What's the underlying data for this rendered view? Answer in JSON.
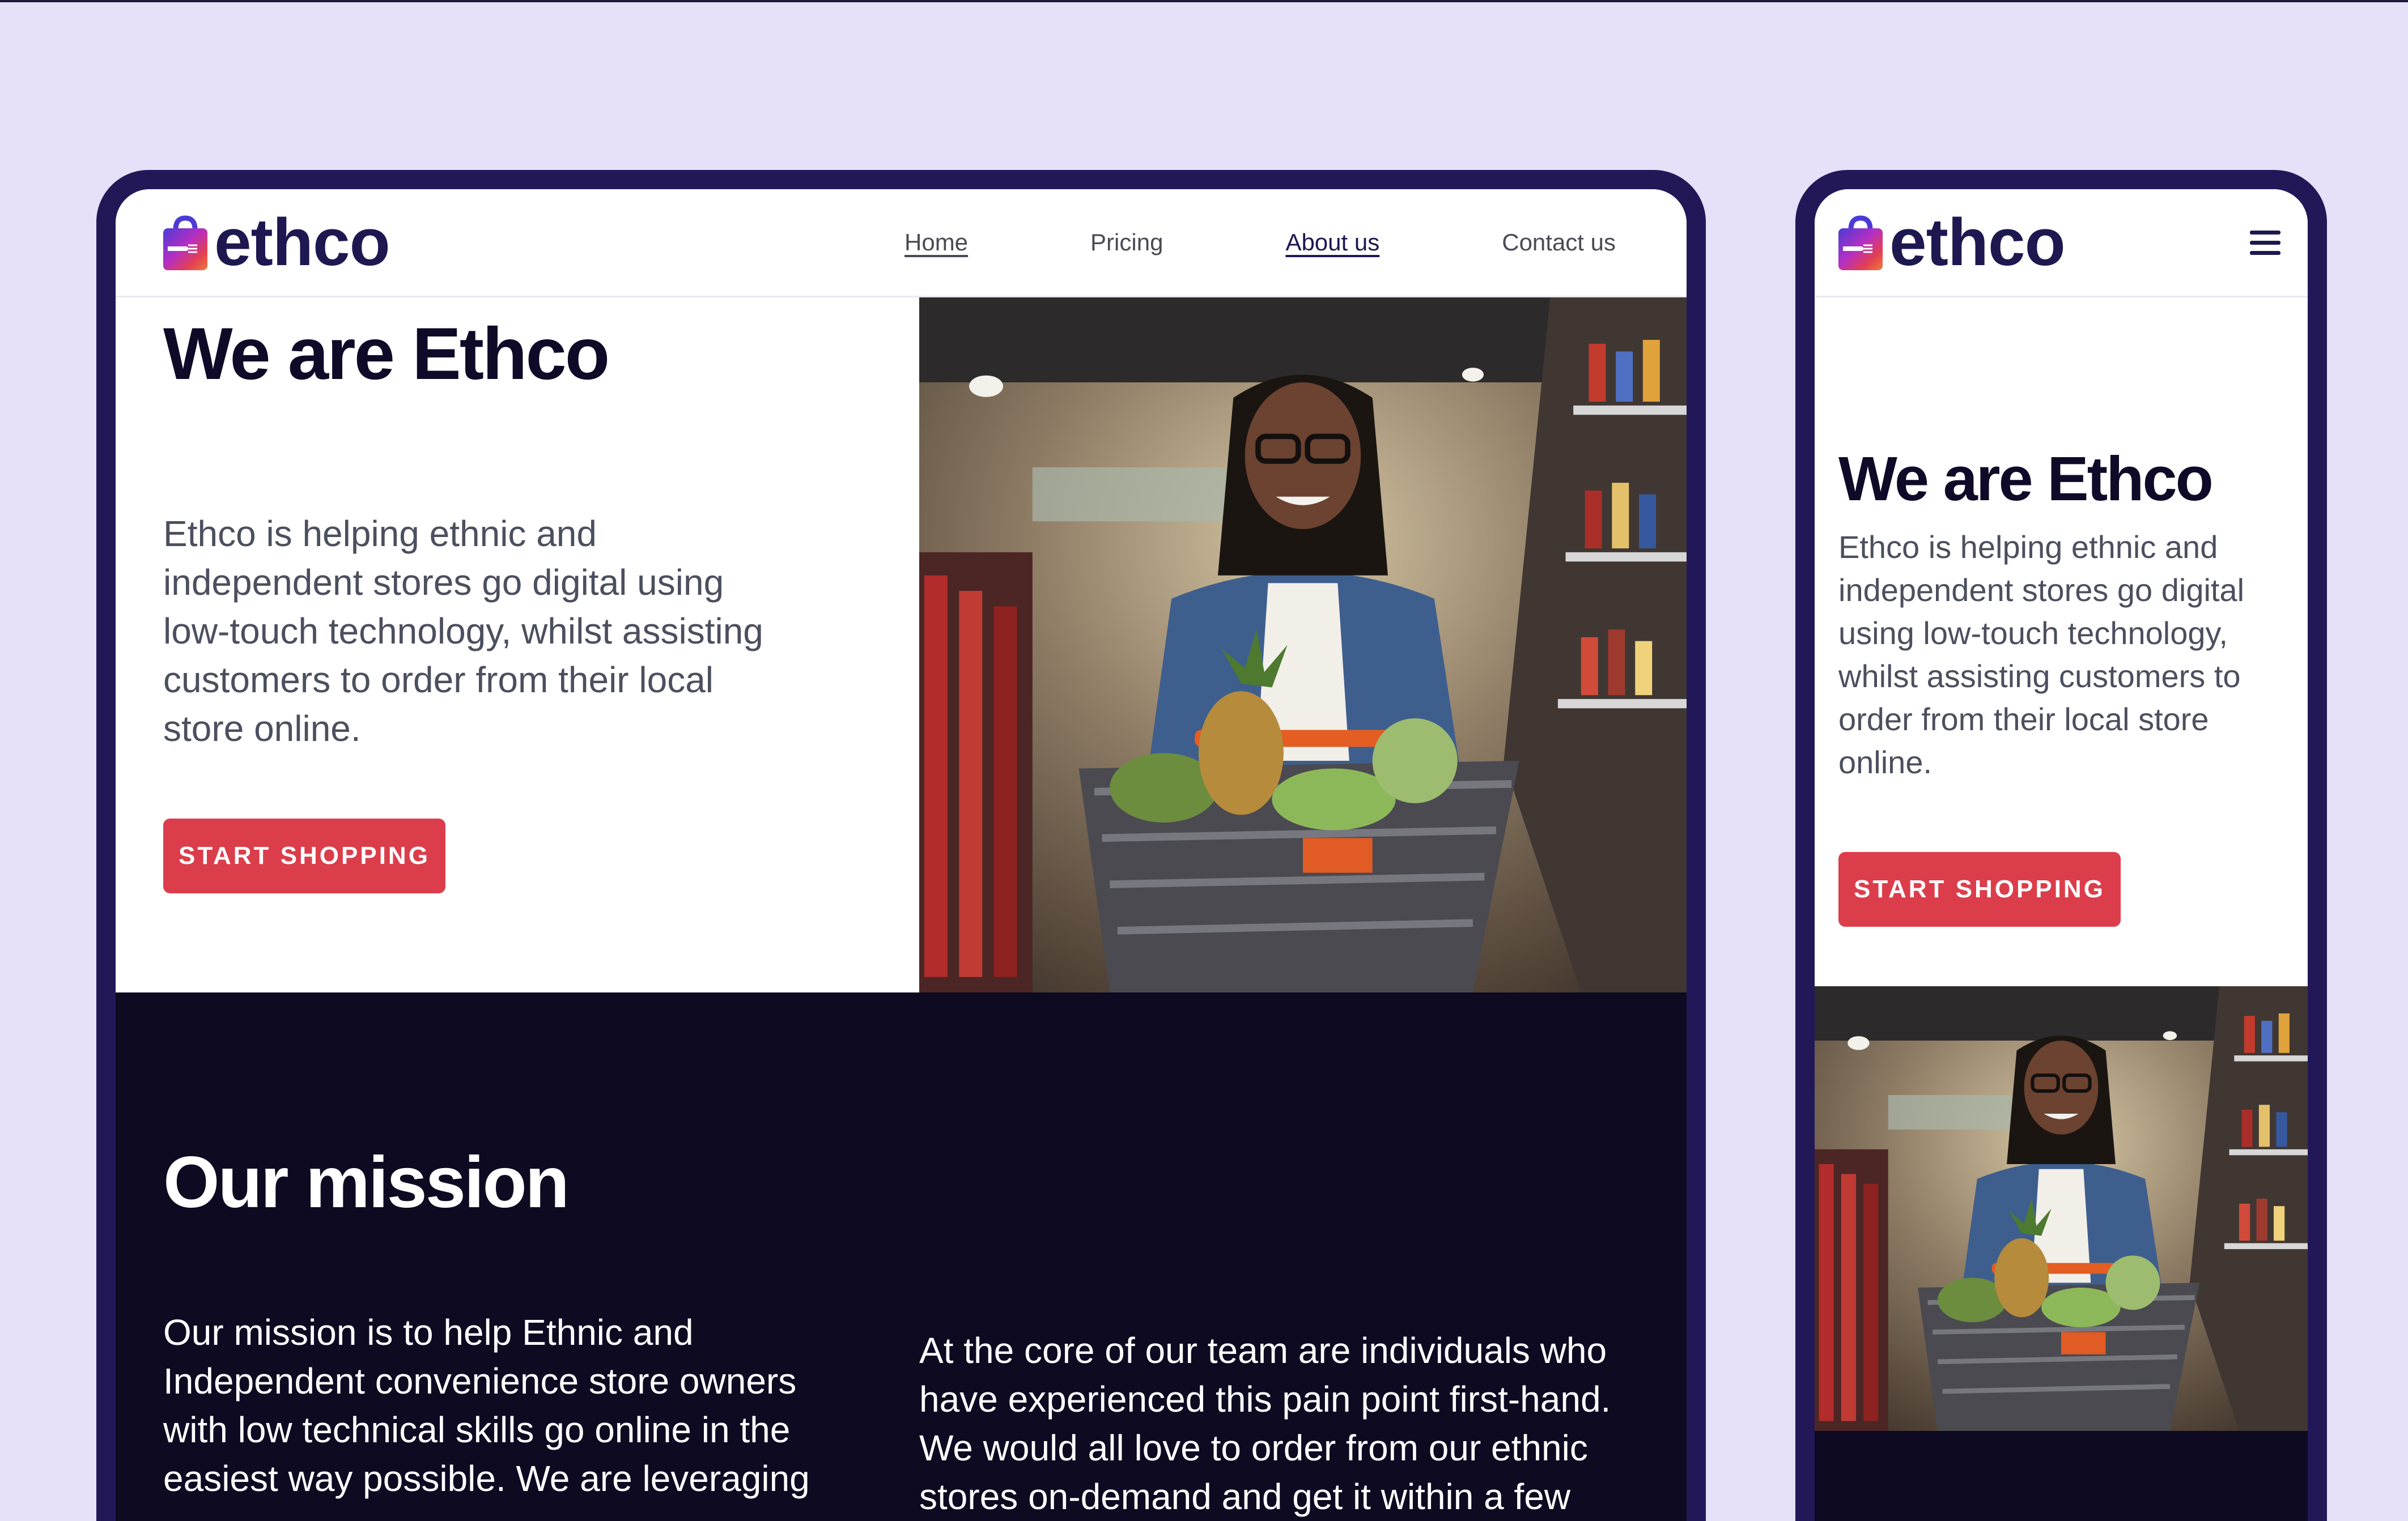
{
  "brand": {
    "name": "ethco",
    "logo_icon": "shopping-bag-icon",
    "logo_colors": [
      "#4b3bd6",
      "#b52fc3",
      "#e33f52",
      "#f07b3d"
    ]
  },
  "colors": {
    "page_background": "#e6e1f8",
    "frame": "#221858",
    "accent": "#dc3d4b",
    "dark_section": "#0d0a22",
    "heading": "#0e0a28"
  },
  "desktop": {
    "nav": [
      {
        "label": "Home"
      },
      {
        "label": "Pricing"
      },
      {
        "label": "About us"
      },
      {
        "label": "Contact us"
      }
    ],
    "hero": {
      "title": "We are Ethco",
      "body": "Ethco is helping ethnic and independent stores go digital using low-touch technology, whilst assisting customers to order from their local store online.",
      "cta": "START SHOPPING"
    },
    "mission": {
      "title": "Our mission",
      "left_text": "Our mission is to help Ethnic and Independent convenience store owners with low technical skills go online in the easiest way possible. We are leveraging",
      "right_text": "At the core of our team are individuals who have experienced this pain point first-hand. We would all love to order from our ethnic stores on-demand and get it within a few"
    }
  },
  "mobile": {
    "menu_icon": "hamburger-menu-icon",
    "hero": {
      "title": "We are Ethco",
      "body": "Ethco is helping ethnic and independent stores go digital using low-touch technology, whilst assisting customers to order from their local store online.",
      "cta": "START SHOPPING"
    }
  }
}
